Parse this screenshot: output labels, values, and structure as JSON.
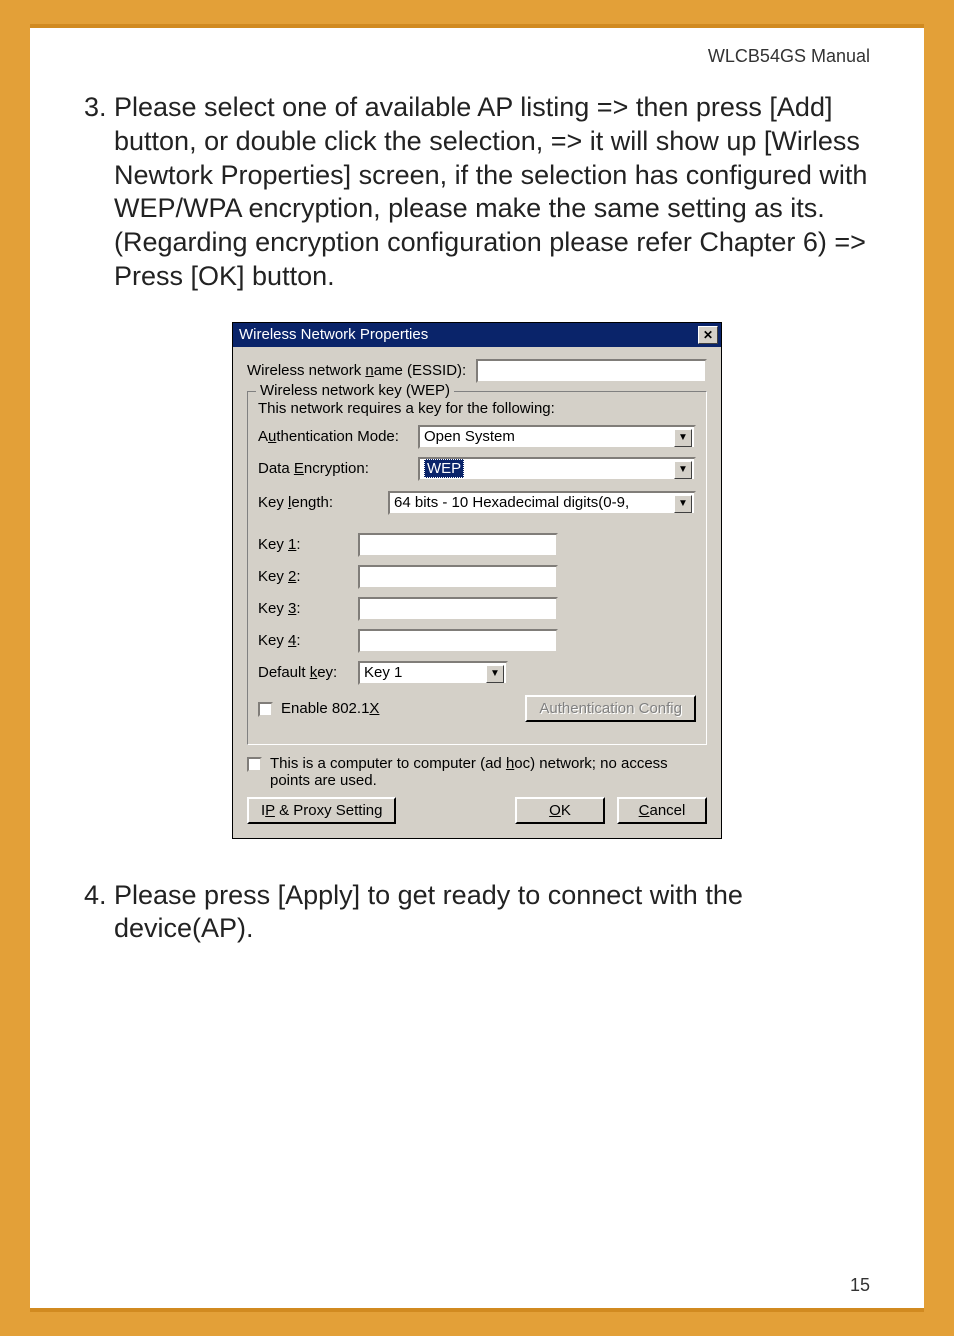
{
  "header": {
    "title": "WLCB54GS Manual"
  },
  "instructions": {
    "step3_num": "3.",
    "step3": "Please select one of available AP listing => then press [Add] button, or double click the selection, => it will show up [Wirless Newtork Properties] screen, if the selection has configured with WEP/WPA encryption, please make the same setting as its. (Regarding encryption configuration please refer Chapter 6) => Press [OK] button.",
    "step4_num": "4.",
    "step4": "Please press [Apply] to get ready to connect with the device(AP)."
  },
  "dialog": {
    "title": "Wireless Network Properties",
    "essid_label_pre": "Wireless network ",
    "essid_label_u": "n",
    "essid_label_post": "ame (ESSID):",
    "essid_value": "",
    "group_legend": "Wireless network key (WEP)",
    "group_desc": "This network requires a key for the following:",
    "auth_label_pre": "A",
    "auth_label_u": "u",
    "auth_label_post": "thentication Mode:",
    "auth_value": "Open System",
    "enc_label_pre": "Data ",
    "enc_label_u": "E",
    "enc_label_post": "ncryption:",
    "enc_value": "WEP",
    "keylen_label_pre": "Key ",
    "keylen_label_u": "l",
    "keylen_label_post": "ength:",
    "keylen_value": "64 bits - 10 Hexadecimal digits(0-9,",
    "key1_label_pre": "Key ",
    "key1_label_u": "1",
    "key1_label_post": ":",
    "key2_label_pre": "Key ",
    "key2_label_u": "2",
    "key2_label_post": ":",
    "key3_label_pre": "Key ",
    "key3_label_u": "3",
    "key3_label_post": ":",
    "key4_label_pre": "Key ",
    "key4_label_u": "4",
    "key4_label_post": ":",
    "defkey_label_pre": "Default ",
    "defkey_label_u": "k",
    "defkey_label_post": "ey:",
    "defkey_value": "Key 1",
    "enable_8021x_pre": "Enable 802.1",
    "enable_8021x_u": "X",
    "auth_config_btn": "Authentication Config",
    "adhoc_pre": "This is a computer to computer (ad ",
    "adhoc_u": "h",
    "adhoc_post": "oc) network; no access points are used.",
    "ip_btn_pre": "I",
    "ip_btn_u": "P",
    "ip_btn_post": " & Proxy Setting",
    "ok_btn_u": "O",
    "ok_btn_post": "K",
    "cancel_btn_u": "C",
    "cancel_btn_post": "ancel"
  },
  "footer": {
    "page": "15"
  }
}
